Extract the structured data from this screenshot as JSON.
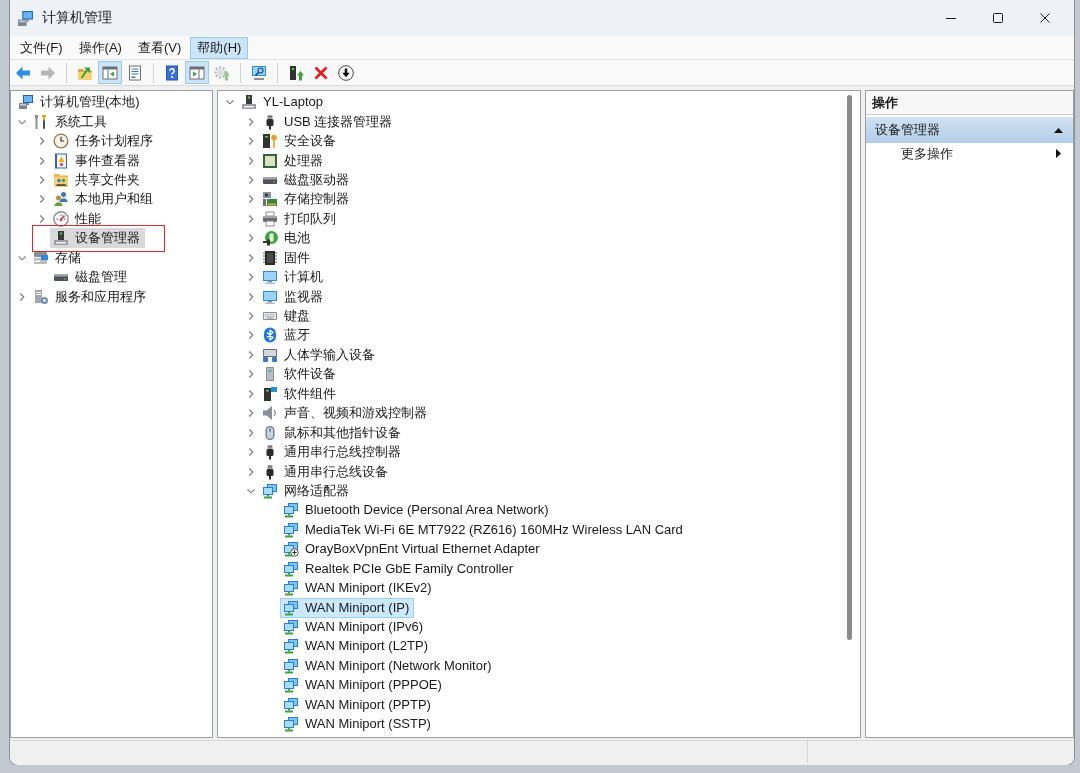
{
  "window": {
    "title": "计算机管理"
  },
  "menu": [
    {
      "label": "文件(F)",
      "selected": false
    },
    {
      "label": "操作(A)",
      "selected": false
    },
    {
      "label": "查看(V)",
      "selected": false
    },
    {
      "label": "帮助(H)",
      "selected": true
    }
  ],
  "toolbar": [
    {
      "buttons": [
        {
          "kind": "back",
          "pressed": false,
          "disabled": false
        },
        {
          "kind": "forward",
          "pressed": false,
          "disabled": true
        }
      ]
    },
    {
      "buttons": [
        {
          "kind": "up",
          "pressed": false,
          "disabled": false
        },
        {
          "kind": "tree",
          "pressed": true,
          "disabled": false
        },
        {
          "kind": "properties",
          "pressed": false,
          "disabled": false
        }
      ]
    },
    {
      "buttons": [
        {
          "kind": "help",
          "pressed": false,
          "disabled": false
        },
        {
          "kind": "pane",
          "pressed": true,
          "disabled": false
        },
        {
          "kind": "update",
          "pressed": false,
          "disabled": true
        }
      ]
    },
    {
      "buttons": [
        {
          "kind": "scan",
          "pressed": false,
          "disabled": false
        }
      ]
    },
    {
      "buttons": [
        {
          "kind": "enable",
          "pressed": false,
          "disabled": false
        },
        {
          "kind": "uninstall",
          "pressed": false,
          "disabled": false
        },
        {
          "kind": "disable",
          "pressed": false,
          "disabled": false
        }
      ]
    }
  ],
  "console_tree": [
    {
      "label": "计算机管理(本地)",
      "kind": "management",
      "selected": false,
      "children": [
        {
          "label": "系统工具",
          "kind": "tools",
          "expanded": true,
          "selected": false,
          "children": [
            {
              "label": "任务计划程序",
              "kind": "scheduler",
              "expanded": false,
              "selected": false
            },
            {
              "label": "事件查看器",
              "kind": "events",
              "expanded": false,
              "selected": false
            },
            {
              "label": "共享文件夹",
              "kind": "shares",
              "expanded": false,
              "selected": false
            },
            {
              "label": "本地用户和组",
              "kind": "users",
              "expanded": false,
              "selected": false
            },
            {
              "label": "性能",
              "kind": "performance",
              "expanded": false,
              "selected": false
            },
            {
              "label": "设备管理器",
              "kind": "device",
              "selected": true,
              "annotated": true
            }
          ]
        },
        {
          "label": "存储",
          "kind": "storage",
          "expanded": true,
          "selected": false,
          "children": [
            {
              "label": "磁盘管理",
              "kind": "disk",
              "selected": false
            }
          ]
        },
        {
          "label": "服务和应用程序",
          "kind": "services",
          "expanded": false,
          "selected": false
        }
      ]
    }
  ],
  "device_tree": [
    {
      "label": "YL-Laptop",
      "kind": "device",
      "expanded": true,
      "selected": false,
      "children": [
        {
          "label": "USB 连接器管理器",
          "kind": "usb",
          "expanded": false,
          "selected": false
        },
        {
          "label": "安全设备",
          "kind": "security",
          "expanded": false,
          "selected": false
        },
        {
          "label": "处理器",
          "kind": "processor",
          "expanded": false,
          "selected": false
        },
        {
          "label": "磁盘驱动器",
          "kind": "disk",
          "expanded": false,
          "selected": false
        },
        {
          "label": "存储控制器",
          "kind": "controller",
          "expanded": false,
          "selected": false
        },
        {
          "label": "打印队列",
          "kind": "printer",
          "expanded": false,
          "selected": false
        },
        {
          "label": "电池",
          "kind": "battery",
          "expanded": false,
          "selected": false
        },
        {
          "label": "固件",
          "kind": "firmware",
          "expanded": false,
          "selected": false
        },
        {
          "label": "计算机",
          "kind": "computer",
          "expanded": false,
          "selected": false
        },
        {
          "label": "监视器",
          "kind": "monitor",
          "expanded": false,
          "selected": false
        },
        {
          "label": "键盘",
          "kind": "keyboard",
          "expanded": false,
          "selected": false
        },
        {
          "label": "蓝牙",
          "kind": "bluetooth",
          "expanded": false,
          "selected": false
        },
        {
          "label": "人体学输入设备",
          "kind": "hid",
          "expanded": false,
          "selected": false
        },
        {
          "label": "软件设备",
          "kind": "software",
          "expanded": false,
          "selected": false
        },
        {
          "label": "软件组件",
          "kind": "component",
          "expanded": false,
          "selected": false
        },
        {
          "label": "声音、视频和游戏控制器",
          "kind": "sound",
          "expanded": false,
          "selected": false
        },
        {
          "label": "鼠标和其他指针设备",
          "kind": "mouse",
          "expanded": false,
          "selected": false
        },
        {
          "label": "通用串行总线控制器",
          "kind": "usb",
          "expanded": false,
          "selected": false
        },
        {
          "label": "通用串行总线设备",
          "kind": "usb",
          "expanded": false,
          "selected": false
        },
        {
          "label": "网络适配器",
          "kind": "network",
          "expanded": true,
          "selected": false,
          "children": [
            {
              "label": "Bluetooth Device (Personal Area Network)",
              "kind": "network",
              "selected": false
            },
            {
              "label": "MediaTek Wi-Fi 6E MT7922 (RZ616) 160MHz Wireless LAN Card",
              "kind": "network",
              "selected": false
            },
            {
              "label": "OrayBoxVpnEnt Virtual Ethernet Adapter",
              "kind": "virtual",
              "selected": false
            },
            {
              "label": "Realtek PCIe GbE Family Controller",
              "kind": "network",
              "selected": false
            },
            {
              "label": "WAN Miniport (IKEv2)",
              "kind": "network",
              "selected": false
            },
            {
              "label": "WAN Miniport (IP)",
              "kind": "network",
              "selected": true
            },
            {
              "label": "WAN Miniport (IPv6)",
              "kind": "network",
              "selected": false
            },
            {
              "label": "WAN Miniport (L2TP)",
              "kind": "network",
              "selected": false
            },
            {
              "label": "WAN Miniport (Network Monitor)",
              "kind": "network",
              "selected": false
            },
            {
              "label": "WAN Miniport (PPPOE)",
              "kind": "network",
              "selected": false
            },
            {
              "label": "WAN Miniport (PPTP)",
              "kind": "network",
              "selected": false
            },
            {
              "label": "WAN Miniport (SSTP)",
              "kind": "network",
              "selected": false
            }
          ]
        }
      ]
    }
  ],
  "actions_pane": {
    "title": "操作",
    "sections": [
      {
        "title": "设备管理器",
        "expanded": true,
        "items": [
          {
            "label": "更多操作"
          }
        ]
      }
    ]
  }
}
